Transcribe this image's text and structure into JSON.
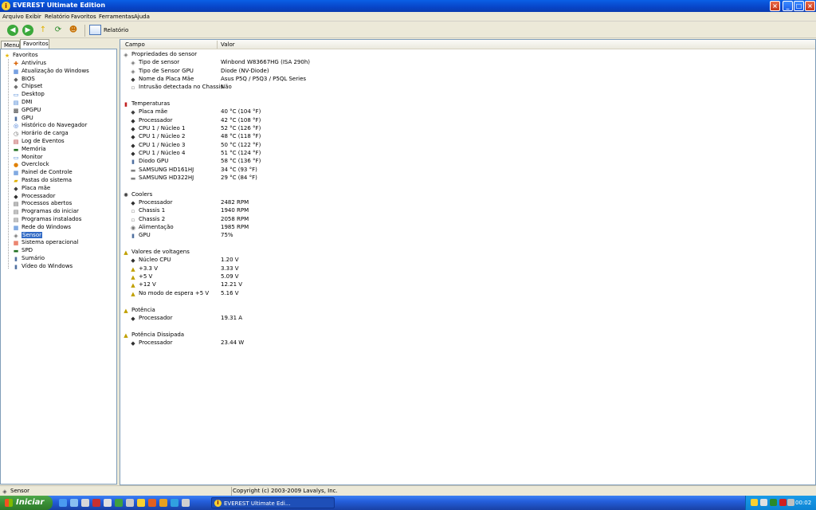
{
  "window": {
    "title": "EVEREST Ultimate Edition"
  },
  "menu": [
    "Arquivo",
    "Exibir",
    "Relatório",
    "Favoritos",
    "Ferramentas",
    "Ajuda"
  ],
  "toolbar": {
    "report_label": "Relatório"
  },
  "left_tabs": [
    "Menu",
    "Favoritos"
  ],
  "tree": {
    "root": "Favoritos",
    "items": [
      {
        "label": "Antivírus",
        "icon": "antivirus-icon"
      },
      {
        "label": "Atualização do Windows",
        "icon": "windows-update-icon"
      },
      {
        "label": "BIOS",
        "icon": "bios-icon"
      },
      {
        "label": "Chipset",
        "icon": "chipset-icon"
      },
      {
        "label": "Desktop",
        "icon": "desktop-icon"
      },
      {
        "label": "DMI",
        "icon": "dmi-icon"
      },
      {
        "label": "GPGPU",
        "icon": "gpgpu-icon"
      },
      {
        "label": "GPU",
        "icon": "gpu-icon"
      },
      {
        "label": "Histórico do Navegador",
        "icon": "browser-history-icon"
      },
      {
        "label": "Horário de carga",
        "icon": "clock-icon"
      },
      {
        "label": "Log de Eventos",
        "icon": "event-log-icon"
      },
      {
        "label": "Memória",
        "icon": "memory-icon"
      },
      {
        "label": "Monitor",
        "icon": "monitor-icon"
      },
      {
        "label": "Overclock",
        "icon": "overclock-icon"
      },
      {
        "label": "Painel de Controle",
        "icon": "control-panel-icon"
      },
      {
        "label": "Pastas do sistema",
        "icon": "folder-icon"
      },
      {
        "label": "Placa mãe",
        "icon": "motherboard-icon"
      },
      {
        "label": "Processador",
        "icon": "processor-icon"
      },
      {
        "label": "Processos abertos",
        "icon": "processes-icon"
      },
      {
        "label": "Programas do iniciar",
        "icon": "startup-programs-icon"
      },
      {
        "label": "Programas instalados",
        "icon": "installed-programs-icon"
      },
      {
        "label": "Rede do Windows",
        "icon": "network-icon"
      },
      {
        "label": "Sensor",
        "icon": "sensor-icon"
      },
      {
        "label": "Sistema operacional",
        "icon": "os-icon"
      },
      {
        "label": "SPD",
        "icon": "spd-icon"
      },
      {
        "label": "Sumário",
        "icon": "summary-icon"
      },
      {
        "label": "Vídeo do Windows",
        "icon": "video-icon"
      }
    ],
    "selected": "Sensor"
  },
  "columns": {
    "field": "Campo",
    "value": "Valor"
  },
  "sections": [
    {
      "title": "Propriedades do sensor",
      "icon": "sensor-icon",
      "rows": [
        {
          "field": "Tipo de sensor",
          "value": "Winbond W83667HG  (ISA 290h)",
          "icon": "sensor-icon"
        },
        {
          "field": "Tipo de Sensor GPU",
          "value": "Diode  (NV-Diode)",
          "icon": "sensor-icon"
        },
        {
          "field": "Nome da Placa Mãe",
          "value": "Asus P5Q / P5Q3 / P5QL Series",
          "icon": "motherboard-icon"
        },
        {
          "field": "Intrusão detectada no Chassis",
          "value": "Não",
          "icon": "chassis-icon"
        }
      ]
    },
    {
      "title": "Temperaturas",
      "icon": "thermometer-icon",
      "rows": [
        {
          "field": "Placa mãe",
          "value": "40 °C  (104 °F)",
          "icon": "motherboard-icon"
        },
        {
          "field": "Processador",
          "value": "42 °C  (108 °F)",
          "icon": "processor-icon"
        },
        {
          "field": "CPU 1 / Núcleo 1",
          "value": "52 °C  (126 °F)",
          "icon": "processor-icon"
        },
        {
          "field": "CPU 1 / Núcleo 2",
          "value": "48 °C  (118 °F)",
          "icon": "processor-icon"
        },
        {
          "field": "CPU 1 / Núcleo 3",
          "value": "50 °C  (122 °F)",
          "icon": "processor-icon"
        },
        {
          "field": "CPU 1 / Núcleo 4",
          "value": "51 °C  (124 °F)",
          "icon": "processor-icon"
        },
        {
          "field": "Diodo GPU",
          "value": "58 °C  (136 °F)",
          "icon": "gpu-icon"
        },
        {
          "field": "SAMSUNG HD161HJ",
          "value": "34 °C  (93 °F)",
          "icon": "hdd-icon"
        },
        {
          "field": "SAMSUNG HD322HJ",
          "value": "29 °C  (84 °F)",
          "icon": "hdd-icon"
        }
      ]
    },
    {
      "title": "Coolers",
      "icon": "fan-icon",
      "rows": [
        {
          "field": "Processador",
          "value": "2482 RPM",
          "icon": "processor-icon"
        },
        {
          "field": "Chassis 1",
          "value": "1940 RPM",
          "icon": "chassis-icon"
        },
        {
          "field": "Chassis 2",
          "value": "2058 RPM",
          "icon": "chassis-icon"
        },
        {
          "field": "Alimentação",
          "value": "1985 RPM",
          "icon": "power-supply-icon"
        },
        {
          "field": "GPU",
          "value": "75%",
          "icon": "gpu-icon"
        }
      ]
    },
    {
      "title": "Valores de voltagens",
      "icon": "voltage-icon",
      "rows": [
        {
          "field": "Núcleo CPU",
          "value": "1.20 V",
          "icon": "processor-icon"
        },
        {
          "field": "+3.3 V",
          "value": "3.33 V",
          "icon": "voltage-icon"
        },
        {
          "field": "+5 V",
          "value": "5.09 V",
          "icon": "voltage-icon"
        },
        {
          "field": "+12 V",
          "value": "12.21 V",
          "icon": "voltage-icon"
        },
        {
          "field": "No modo de espera +5 V",
          "value": "5.16 V",
          "icon": "voltage-icon"
        }
      ]
    },
    {
      "title": "Potência",
      "icon": "voltage-icon",
      "rows": [
        {
          "field": "Processador",
          "value": "19.31 A",
          "icon": "processor-icon"
        }
      ]
    },
    {
      "title": "Potência Dissipada",
      "icon": "voltage-icon",
      "rows": [
        {
          "field": "Processador",
          "value": "23.44 W",
          "icon": "processor-icon"
        }
      ]
    }
  ],
  "status": {
    "left": "Sensor",
    "right": "Copyright (c) 2003-2009 Lavalys, Inc."
  },
  "taskbar": {
    "start_label": "Iniciar",
    "task_label": "EVEREST Ultimate Edi...",
    "clock": "00:02"
  }
}
